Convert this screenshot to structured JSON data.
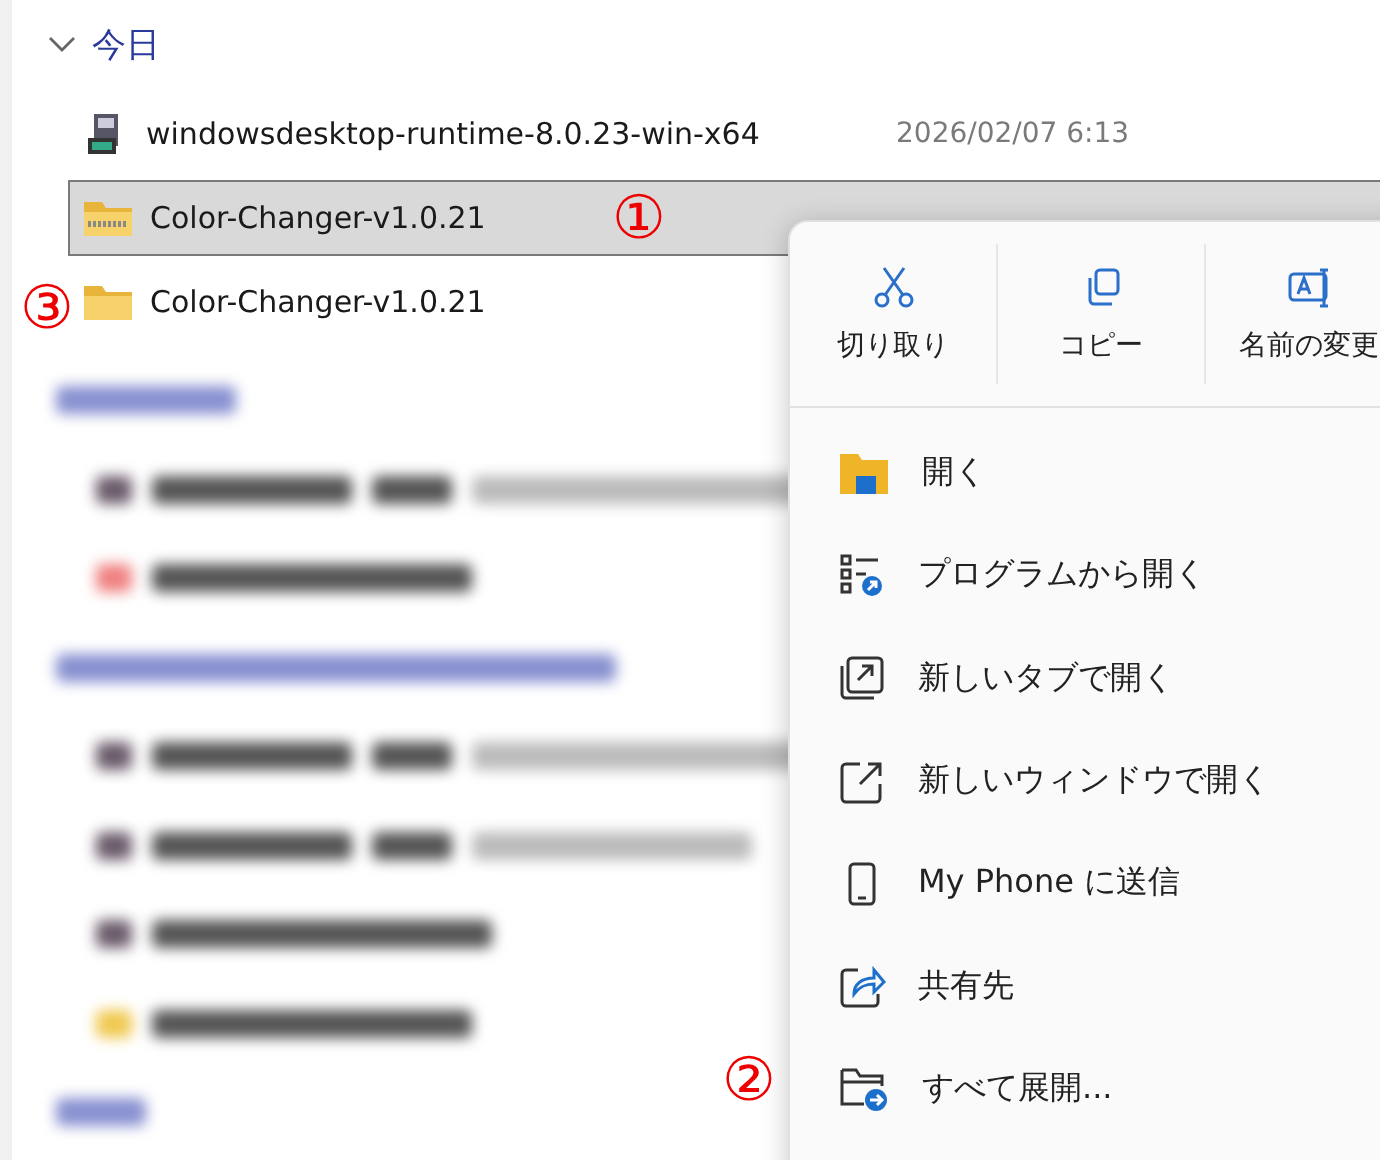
{
  "group": {
    "label": "今日",
    "expanded": true
  },
  "files": [
    {
      "name": "windowsdesktop-runtime-8.0.23-win-x64",
      "kind": "installer",
      "date": "2026/02/07 6:13",
      "selected": false
    },
    {
      "name": "Color-Changer-v1.0.21",
      "kind": "zip",
      "selected": true
    },
    {
      "name": "Color-Changer-v1.0.21",
      "kind": "folder",
      "selected": false
    }
  ],
  "blurred_rows": [
    {
      "kind": "group"
    },
    {
      "kind": "video"
    },
    {
      "kind": "pdf"
    },
    {
      "kind": "group"
    },
    {
      "kind": "video"
    },
    {
      "kind": "video"
    },
    {
      "kind": "video"
    },
    {
      "kind": "folder"
    },
    {
      "kind": "group"
    }
  ],
  "context_menu": {
    "actions": [
      {
        "label": "切り取り",
        "kind": "cut"
      },
      {
        "label": "コピー",
        "kind": "copy"
      },
      {
        "label": "名前の変更",
        "kind": "rename"
      }
    ],
    "items": [
      {
        "label": "開く",
        "kind": "open"
      },
      {
        "label": "プログラムから開く",
        "kind": "openwith"
      },
      {
        "label": "新しいタブで開く",
        "kind": "newtab"
      },
      {
        "label": "新しいウィンドウで開く",
        "kind": "newwindow"
      },
      {
        "label": "My Phone に送信",
        "kind": "phone"
      },
      {
        "label": "共有先",
        "kind": "share"
      },
      {
        "label": "すべて展開...",
        "kind": "extract"
      }
    ]
  },
  "annotations": [
    {
      "label": "①",
      "kind": "selected"
    },
    {
      "label": "②",
      "kind": "extract"
    },
    {
      "label": "③",
      "kind": "folder"
    }
  ]
}
